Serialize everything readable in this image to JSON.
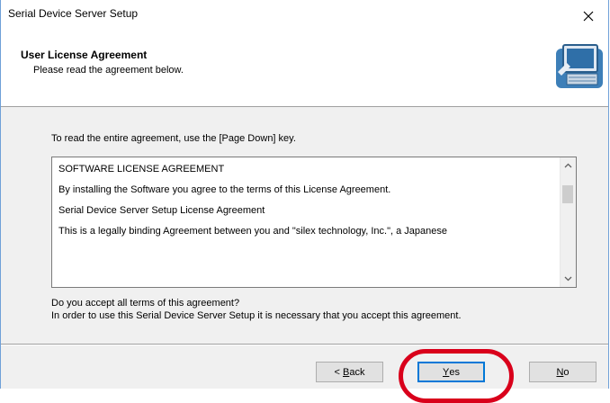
{
  "window": {
    "title": "Serial Device Server Setup"
  },
  "header": {
    "title": "User License Agreement",
    "subtitle": "Please read the agreement below."
  },
  "instruction": "To read the entire agreement, use the [Page Down] key.",
  "license": {
    "lines": [
      "SOFTWARE LICENSE AGREEMENT",
      "By installing the Software you agree to the terms of this License Agreement.",
      "Serial Device Server Setup License Agreement",
      "This is a legally binding Agreement between you and \"silex technology, Inc.\", a Japanese"
    ]
  },
  "question": {
    "line1": "Do you accept all terms of this agreement?",
    "line2": "In order to use this Serial Device Server Setup it is necessary that you accept this agreement."
  },
  "buttons": {
    "back_prefix": "< ",
    "back_mnemonic": "B",
    "back_rest": "ack",
    "yes_mnemonic": "Y",
    "yes_rest": "es",
    "no_mnemonic": "N",
    "no_rest": "o"
  },
  "colors": {
    "highlight": "#d9001b",
    "focus_border": "#0078d7"
  }
}
